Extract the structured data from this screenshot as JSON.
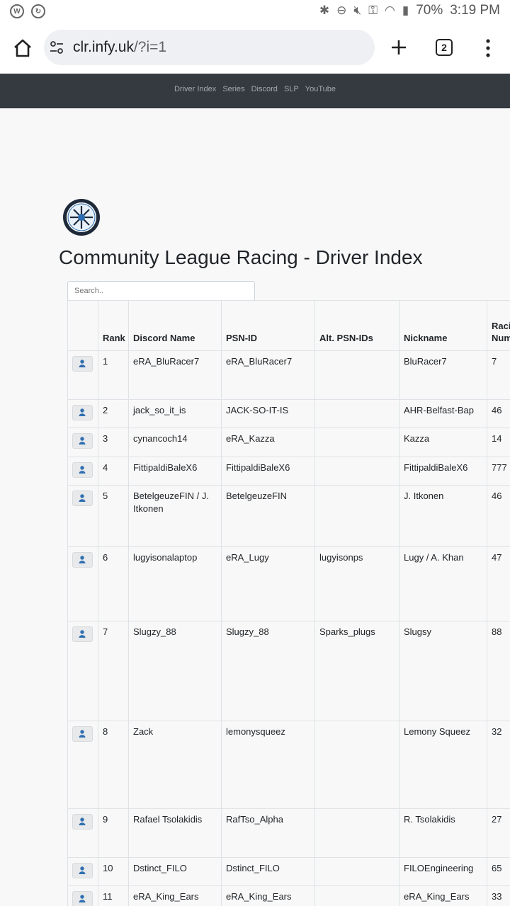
{
  "status": {
    "battery": "70%",
    "time": "3:19 PM"
  },
  "browser": {
    "url_host": "clr.infy.uk",
    "url_path": "/?i=1",
    "tab_count": "2"
  },
  "nav": {
    "links": [
      "Driver Index",
      "Series",
      "Discord",
      "SLP",
      "YouTube"
    ]
  },
  "page": {
    "title": "Community League Racing - Driver Index",
    "search_placeholder": "Search.."
  },
  "table": {
    "headers": [
      "",
      "Rank",
      "Discord Name",
      "PSN-ID",
      "Alt. PSN-IDs",
      "Nickname",
      "Racing Number"
    ],
    "rows": [
      {
        "rank": "1",
        "discord": "eRA_BluRacer7",
        "psn": "eRA_BluRacer7",
        "alt": "",
        "nick": "BluRacer7",
        "num": "7"
      },
      {
        "rank": "2",
        "discord": "jack_so_it_is",
        "psn": "JACK-SO-IT-IS",
        "alt": "",
        "nick": "AHR-Belfast-Bap",
        "num": "46"
      },
      {
        "rank": "3",
        "discord": "cynancoch14",
        "psn": "eRA_Kazza",
        "alt": "",
        "nick": "Kazza",
        "num": "14"
      },
      {
        "rank": "4",
        "discord": "FittipaldiBaleX6",
        "psn": "FittipaldiBaleX6",
        "alt": "",
        "nick": "FittipaldiBaleX6",
        "num": "777"
      },
      {
        "rank": "5",
        "discord": "BetelgeuzeFIN / J. Itkonen",
        "psn": "BetelgeuzeFIN",
        "alt": "",
        "nick": "J. Itkonen",
        "num": "46"
      },
      {
        "rank": "6",
        "discord": "lugyisonalaptop",
        "psn": "eRA_Lugy",
        "alt": "lugyisonps",
        "nick": "Lugy / A. Khan",
        "num": "47"
      },
      {
        "rank": "7",
        "discord": "Slugzy_88",
        "psn": "Slugzy_88",
        "alt": "Sparks_plugs",
        "nick": "Slugsy",
        "num": "88"
      },
      {
        "rank": "8",
        "discord": "Zack",
        "psn": "lemonysqueez",
        "alt": "",
        "nick": "Lemony Squeez",
        "num": "32"
      },
      {
        "rank": "9",
        "discord": "Rafael Tsolakidis",
        "psn": "RafTso_Alpha",
        "alt": "",
        "nick": "R. Tsolakidis",
        "num": "27"
      },
      {
        "rank": "10",
        "discord": "Dstinct_FILO",
        "psn": "Dstinct_FILO",
        "alt": "",
        "nick": "FILOEngineering",
        "num": "65"
      },
      {
        "rank": "11",
        "discord": "eRA_King_Ears",
        "psn": "eRA_King_Ears",
        "alt": "",
        "nick": "eRA_King_Ears",
        "num": "33"
      }
    ]
  }
}
